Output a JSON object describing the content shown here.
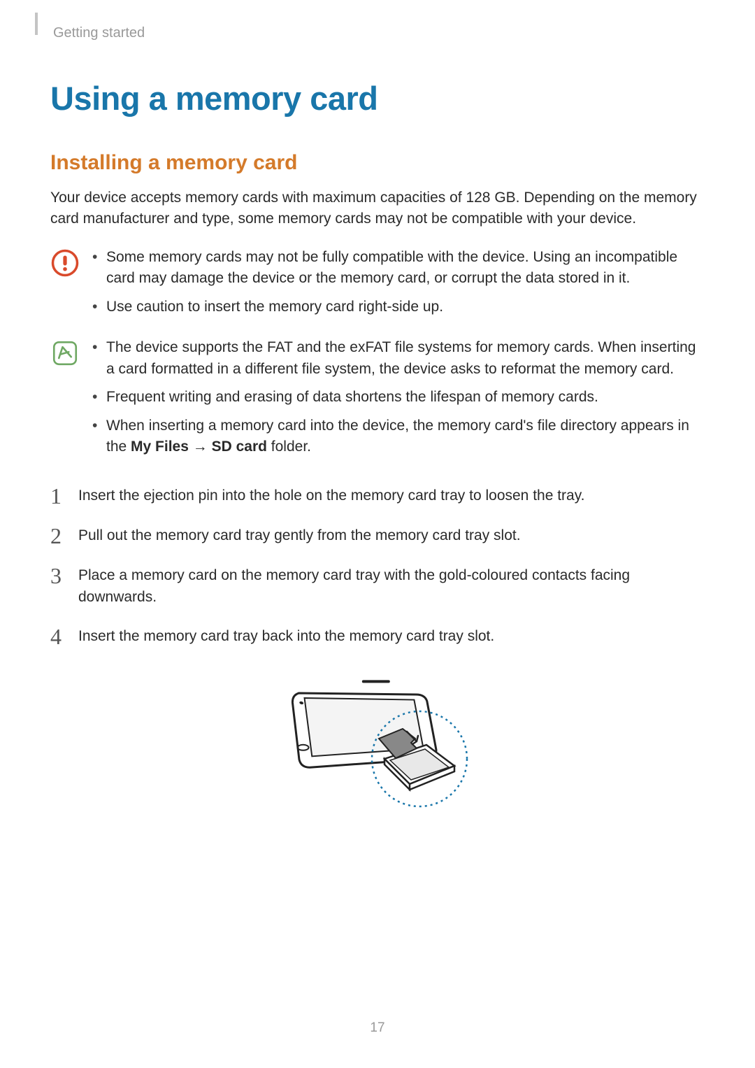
{
  "chapter": "Getting started",
  "heading": "Using a memory card",
  "subheading": "Installing a memory card",
  "intro": "Your device accepts memory cards with maximum capacities of 128 GB. Depending on the memory card manufacturer and type, some memory cards may not be compatible with your device.",
  "warning": {
    "items": [
      "Some memory cards may not be fully compatible with the device. Using an incompatible card may damage the device or the memory card, or corrupt the data stored in it.",
      "Use caution to insert the memory card right-side up."
    ]
  },
  "note": {
    "items": [
      "The device supports the FAT and the exFAT file systems for memory cards. When inserting a card formatted in a different file system, the device asks to reformat the memory card.",
      "Frequent writing and erasing of data shortens the lifespan of memory cards."
    ],
    "item3_prefix": "When inserting a memory card into the device, the memory card's file directory appears in the ",
    "item3_bold1": "My Files",
    "item3_arrow": " → ",
    "item3_bold2": "SD card",
    "item3_suffix": " folder."
  },
  "steps": [
    {
      "num": "1",
      "text": "Insert the ejection pin into the hole on the memory card tray to loosen the tray."
    },
    {
      "num": "2",
      "text": "Pull out the memory card tray gently from the memory card tray slot."
    },
    {
      "num": "3",
      "text": "Place a memory card on the memory card tray with the gold-coloured contacts facing downwards."
    },
    {
      "num": "4",
      "text": "Insert the memory card tray back into the memory card tray slot."
    }
  ],
  "pageNumber": "17"
}
